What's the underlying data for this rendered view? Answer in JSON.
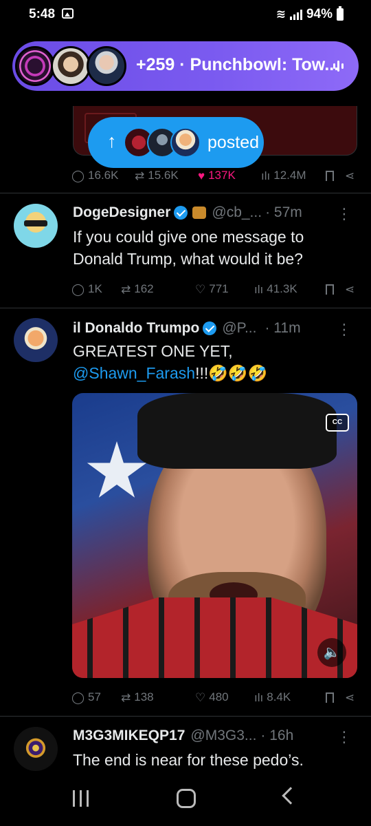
{
  "status_bar": {
    "time": "5:48",
    "battery": "94%"
  },
  "space": {
    "label": "+259 · Punchbowl: Tow..."
  },
  "posted_pill": {
    "arrow": "↑",
    "label": "posted"
  },
  "previous_tweet": {
    "actions": {
      "replies": "16.6K",
      "reposts": "15.6K",
      "likes": "137K",
      "views": "12.4M"
    }
  },
  "tweets": [
    {
      "name": "DogeDesigner",
      "handle": "@cb_...",
      "time": "· 57m",
      "text": "If you could give one message to Donald Trump, what would it be?",
      "actions": {
        "replies": "1K",
        "reposts": "162",
        "likes": "771",
        "views": "41.3K"
      }
    },
    {
      "name": "il Donaldo Trumpo",
      "handle": "@P...",
      "time": "· 11m",
      "text_line1": "GREATEST ONE YET,",
      "mention": "@Shawn_Farash",
      "text_tail": "!!!🤣🤣🤣",
      "video": {
        "cc_label": "CC"
      },
      "actions": {
        "replies": "57",
        "reposts": "138",
        "likes": "480",
        "views": "8.4K"
      }
    },
    {
      "name": "M3G3MIKEQP17",
      "handle": "@M3G3...",
      "time": "· 16h",
      "text": "The end is near for these pedo’s."
    }
  ],
  "icons": {
    "reply": "reply-icon",
    "repost": "repost-icon",
    "like": "heart-icon",
    "views": "views-icon",
    "bookmark": "bookmark-icon",
    "share": "share-icon"
  },
  "colors": {
    "accent": "#1d9bf0",
    "space_purple": "#7b5bf0",
    "like_pink": "#f91880",
    "muted": "#71767b"
  }
}
